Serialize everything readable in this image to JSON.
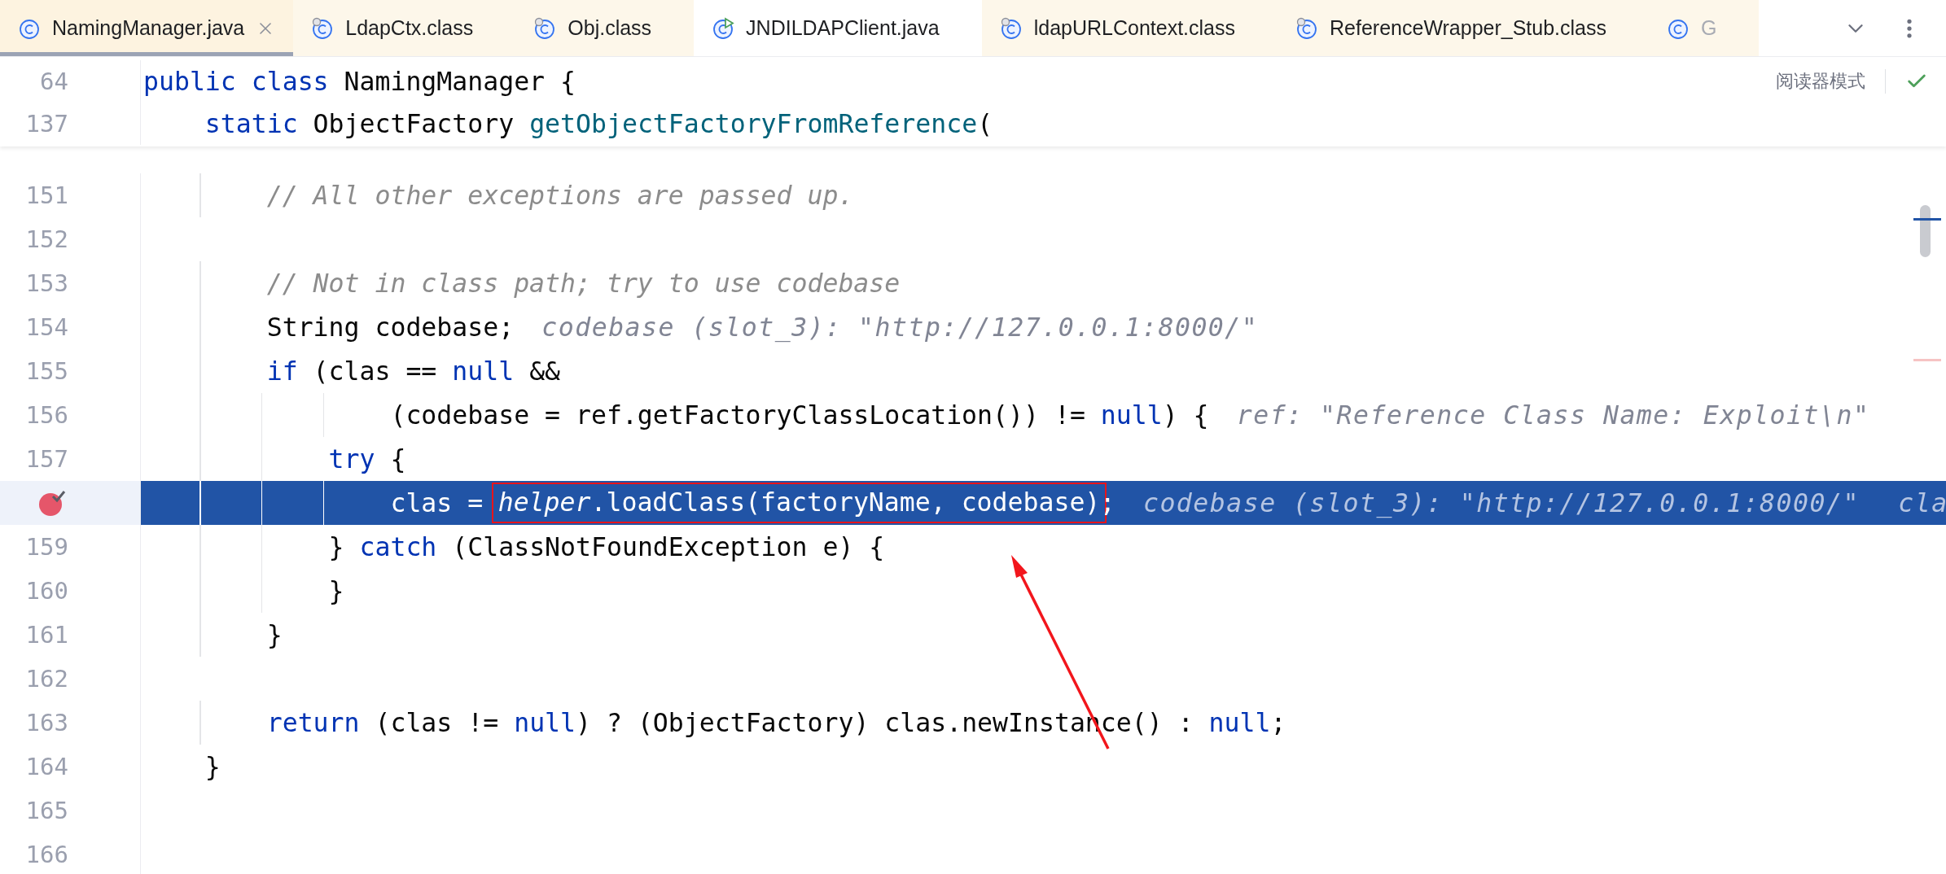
{
  "tabs": [
    {
      "label": "NamingManager.java",
      "kind": "source",
      "selected": true,
      "closable": true,
      "dimmed": false,
      "color": "#fdf3e0"
    },
    {
      "label": "LdapCtx.class",
      "kind": "compiled",
      "selected": false,
      "closable": false,
      "dimmed": false,
      "color": "#fdf7ea"
    },
    {
      "label": "Obj.class",
      "kind": "compiled",
      "selected": false,
      "closable": false,
      "dimmed": false,
      "color": "#fdf7ea"
    },
    {
      "label": "JNDILDAPClient.java",
      "kind": "runnable",
      "selected": false,
      "closable": false,
      "dimmed": false,
      "color": "#ffffff"
    },
    {
      "label": "ldapURLContext.class",
      "kind": "compiled",
      "selected": false,
      "closable": false,
      "dimmed": false,
      "color": "#fdf7ea"
    },
    {
      "label": "ReferenceWrapper_Stub.class",
      "kind": "compiled",
      "selected": false,
      "closable": false,
      "dimmed": false,
      "color": "#fdf7ea"
    },
    {
      "label": "G",
      "kind": "source",
      "selected": false,
      "closable": false,
      "dimmed": true,
      "color": "#fdf7ea"
    }
  ],
  "reader_mode": {
    "label": "阅读器模式",
    "inspection_ok": true
  },
  "sticky_lines": [
    {
      "number": "64",
      "tokens": [
        {
          "kind": "keyword",
          "text": "public class"
        },
        {
          "kind": "plain",
          "text": " NamingManager {"
        }
      ]
    },
    {
      "number": "137",
      "tokens": [
        {
          "kind": "keyword",
          "text": "    static"
        },
        {
          "kind": "plain",
          "text": " ObjectFactory "
        },
        {
          "kind": "method",
          "text": "getObjectFactoryFromReference"
        },
        {
          "kind": "plain",
          "text": "("
        }
      ]
    }
  ],
  "lines": [
    {
      "number": "151",
      "current": false,
      "parts": [
        {
          "kind": "code",
          "tokens": [
            {
              "kind": "comment",
              "text": "        // All other exceptions are passed up."
            }
          ]
        }
      ]
    },
    {
      "number": "152",
      "current": false
    },
    {
      "number": "153",
      "current": false,
      "parts": [
        {
          "kind": "code",
          "tokens": [
            {
              "kind": "comment",
              "text": "        // Not in class path; try to use codebase"
            }
          ]
        }
      ]
    },
    {
      "number": "154",
      "current": false,
      "parts": [
        {
          "kind": "code",
          "tokens": [
            {
              "kind": "plain",
              "text": "        String codebase;"
            }
          ]
        },
        {
          "kind": "hint",
          "text": "codebase (slot_3): \"http://127.0.0.1:8000/\""
        }
      ]
    },
    {
      "number": "155",
      "current": false,
      "parts": [
        {
          "kind": "code",
          "tokens": [
            {
              "kind": "keyword",
              "text": "        if"
            },
            {
              "kind": "plain",
              "text": " (clas == "
            },
            {
              "kind": "keyword",
              "text": "null"
            },
            {
              "kind": "plain",
              "text": " &&"
            }
          ]
        }
      ]
    },
    {
      "number": "156",
      "current": false,
      "parts": [
        {
          "kind": "code",
          "tokens": [
            {
              "kind": "plain",
              "text": "                (codebase = ref.getFactoryClassLocation()) != "
            },
            {
              "kind": "keyword",
              "text": "null"
            },
            {
              "kind": "plain",
              "text": ") {"
            }
          ]
        },
        {
          "kind": "hint",
          "text": "ref: \"Reference Class Name: Exploit\\n\""
        }
      ]
    },
    {
      "number": "157",
      "current": false,
      "parts": [
        {
          "kind": "code",
          "tokens": [
            {
              "kind": "keyword",
              "text": "            try"
            },
            {
              "kind": "plain",
              "text": " {"
            }
          ]
        }
      ]
    },
    {
      "breakpoint": true,
      "current": true,
      "parts": [
        {
          "kind": "code",
          "tokens": [
            {
              "kind": "plain",
              "text": "                clas = "
            }
          ]
        },
        {
          "kind": "marked",
          "tokens": [
            {
              "kind": "field",
              "text": "helper"
            },
            {
              "kind": "plain",
              "text": ".loadClass(factoryName, codebase)"
            }
          ]
        },
        {
          "kind": "code",
          "tokens": [
            {
              "kind": "plain",
              "text": ";"
            }
          ]
        },
        {
          "kind": "hint",
          "text": "codebase (slot_3): \"http://127.0.0.1:8000/\""
        },
        {
          "kind": "hint",
          "text": "cla"
        }
      ]
    },
    {
      "number": "159",
      "current": false,
      "parts": [
        {
          "kind": "code",
          "tokens": [
            {
              "kind": "plain",
              "text": "            } "
            },
            {
              "kind": "keyword",
              "text": "catch"
            },
            {
              "kind": "plain",
              "text": " (ClassNotFoundException e) {"
            }
          ]
        }
      ]
    },
    {
      "number": "160",
      "current": false,
      "parts": [
        {
          "kind": "code",
          "tokens": [
            {
              "kind": "plain",
              "text": "            }"
            }
          ]
        }
      ]
    },
    {
      "number": "161",
      "current": false,
      "parts": [
        {
          "kind": "code",
          "tokens": [
            {
              "kind": "plain",
              "text": "        }"
            }
          ]
        }
      ]
    },
    {
      "number": "162",
      "current": false
    },
    {
      "number": "163",
      "current": false,
      "parts": [
        {
          "kind": "code",
          "tokens": [
            {
              "kind": "keyword",
              "text": "        return"
            },
            {
              "kind": "plain",
              "text": " (clas != "
            },
            {
              "kind": "keyword",
              "text": "null"
            },
            {
              "kind": "plain",
              "text": ") ? (ObjectFactory) clas.newInstance() : "
            },
            {
              "kind": "keyword",
              "text": "null"
            },
            {
              "kind": "plain",
              "text": ";"
            }
          ]
        }
      ]
    },
    {
      "number": "164",
      "current": false,
      "parts": [
        {
          "kind": "code",
          "tokens": [
            {
              "kind": "plain",
              "text": "    }"
            }
          ]
        }
      ]
    },
    {
      "number": "165",
      "current": false
    },
    {
      "number": "166",
      "current": false
    }
  ],
  "annotation": {
    "arrow": true
  }
}
